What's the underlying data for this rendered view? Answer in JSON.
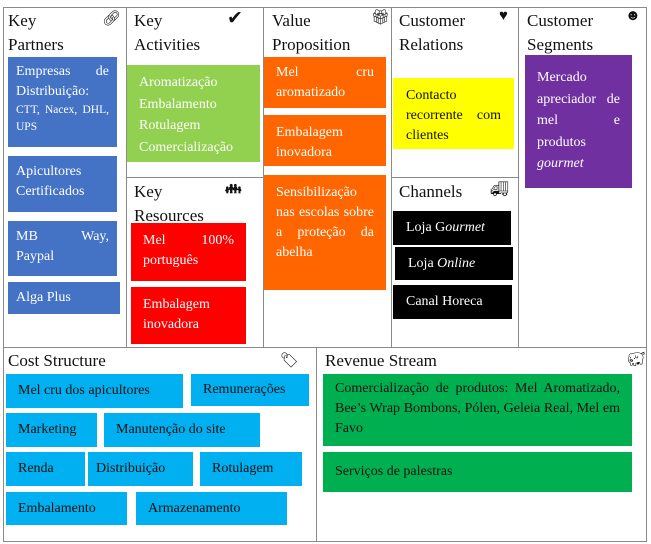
{
  "sections": {
    "key_partners": {
      "title1": "Key",
      "title2": "Partners",
      "icon": "link-icon",
      "items": [
        "Empresas de Distribuição:",
        "CTT, Nacex, DHL, UPS",
        "Apicultores Certificados",
        "MB Way, Paypal",
        "Alga Plus"
      ]
    },
    "key_activities": {
      "title1": "Key",
      "title2": "Activities",
      "icon": "checkmark-icon",
      "items": [
        "Aromatização",
        "Embalamento",
        "Rotulagem",
        "Comercialização"
      ]
    },
    "key_resources": {
      "title1": "Key",
      "title2": "Resources",
      "icon": "people-icon",
      "items": [
        "Mel 100% português",
        "Embalagem inovadora"
      ]
    },
    "value_proposition": {
      "title1": "Value",
      "title2": "Proposition",
      "icon": "gift-icon",
      "items": [
        "Mel cru aromatizado",
        "Embalagem inovadora",
        "Sensibilização nas escolas sobre a proteção da abelha"
      ]
    },
    "customer_relations": {
      "title1": "Customer",
      "title2": "Relations",
      "icon": "heart-icon",
      "items": [
        "Contacto recorrente com clientes"
      ]
    },
    "channels": {
      "title": "Channels",
      "icon": "truck-icon",
      "items": [
        {
          "a": "Loja G",
          "b": "ourmet"
        },
        {
          "a": "Loja ",
          "b": "Online"
        },
        {
          "a": "Canal Horeca",
          "b": ""
        }
      ]
    },
    "customer_segments": {
      "title1": "Customer",
      "title2": "Segments",
      "icon": "smiley-icon",
      "text": "Mercado apreciador de mel e produtos",
      "italic": "gourmet"
    },
    "cost_structure": {
      "title": "Cost Structure",
      "icon": "tag-icon",
      "items": [
        "Mel cru dos apicultores",
        "Remunerações",
        "Marketing",
        "Manutenção do site",
        "Renda",
        "Distribuição",
        "Rotulagem",
        "Embalamento",
        "Armazenamento"
      ]
    },
    "revenue_stream": {
      "title": "Revenue Stream",
      "icon": "piggy-bank-icon",
      "items": [
        "Comercialização de produtos: Mel Aromatizado, Bee’s Wrap Bombons, Pólen, Geleia Real, Mel em Favo",
        "Serviços de palestras"
      ]
    }
  },
  "colors": {
    "partners": "#4472c4",
    "activities": "#92d050",
    "resources": "#ff0000",
    "value": "#ff6600",
    "relations": "#ffff00",
    "channels": "#000000",
    "segments": "#7030a0",
    "cost": "#00b0f0",
    "revenue": "#00b050"
  }
}
